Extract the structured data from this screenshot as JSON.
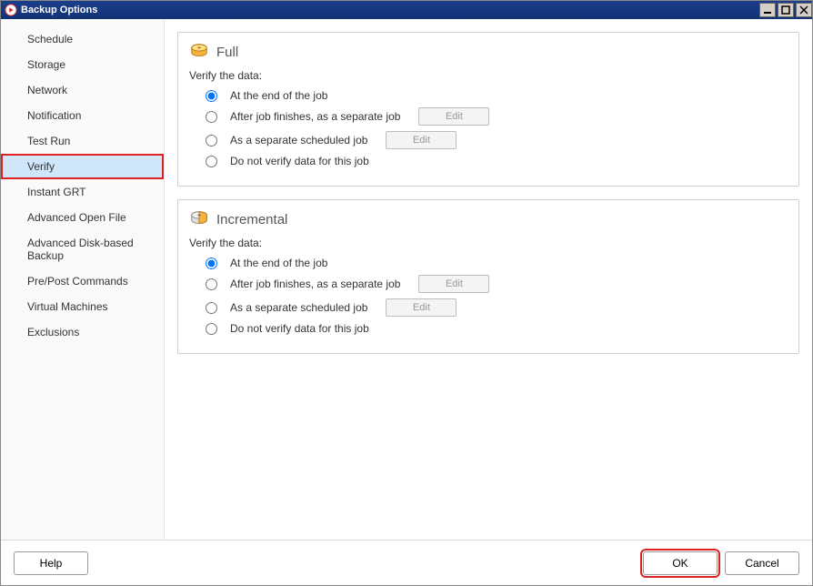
{
  "window": {
    "title": "Backup Options"
  },
  "sidebar": {
    "items": [
      {
        "label": "Schedule"
      },
      {
        "label": "Storage"
      },
      {
        "label": "Network"
      },
      {
        "label": "Notification"
      },
      {
        "label": "Test Run"
      },
      {
        "label": "Verify",
        "selected": true,
        "highlighted": true
      },
      {
        "label": "Instant GRT"
      },
      {
        "label": "Advanced Open File"
      },
      {
        "label": "Advanced Disk-based Backup"
      },
      {
        "label": "Pre/Post Commands"
      },
      {
        "label": "Virtual Machines"
      },
      {
        "label": "Exclusions"
      }
    ]
  },
  "panels": {
    "full": {
      "title": "Full",
      "prompt": "Verify the data:",
      "options": [
        {
          "label": "At the end of the job",
          "selected": true
        },
        {
          "label": "After job finishes, as a separate job",
          "has_edit": true
        },
        {
          "label": "As a separate scheduled job",
          "has_edit": true
        },
        {
          "label": "Do not verify data for this job"
        }
      ],
      "edit_label": "Edit"
    },
    "incremental": {
      "title": "Incremental",
      "prompt": "Verify the data:",
      "options": [
        {
          "label": "At the end of the job",
          "selected": true
        },
        {
          "label": "After job finishes, as a separate job",
          "has_edit": true
        },
        {
          "label": "As a separate scheduled job",
          "has_edit": true
        },
        {
          "label": "Do not verify data for this job"
        }
      ],
      "edit_label": "Edit"
    }
  },
  "footer": {
    "help": "Help",
    "ok": "OK",
    "cancel": "Cancel"
  }
}
